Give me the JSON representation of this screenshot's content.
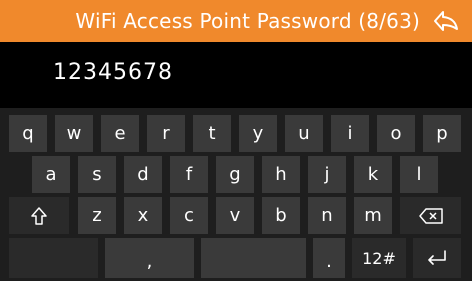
{
  "header": {
    "title": "WiFi Access Point Password (8/63)",
    "back_icon": "back-arrow-icon",
    "color": "#f0892c"
  },
  "input": {
    "value": "12345678"
  },
  "keyboard": {
    "row1": [
      "q",
      "w",
      "e",
      "r",
      "t",
      "y",
      "u",
      "i",
      "o",
      "p"
    ],
    "row2": [
      "a",
      "s",
      "d",
      "f",
      "g",
      "h",
      "j",
      "k",
      "l"
    ],
    "row3": [
      "z",
      "x",
      "c",
      "v",
      "b",
      "n",
      "m"
    ],
    "shift_icon": "shift-icon",
    "backspace_icon": "backspace-icon",
    "comma_label": ",",
    "period_label": ".",
    "symbols_label": "12#",
    "enter_icon": "enter-icon"
  }
}
